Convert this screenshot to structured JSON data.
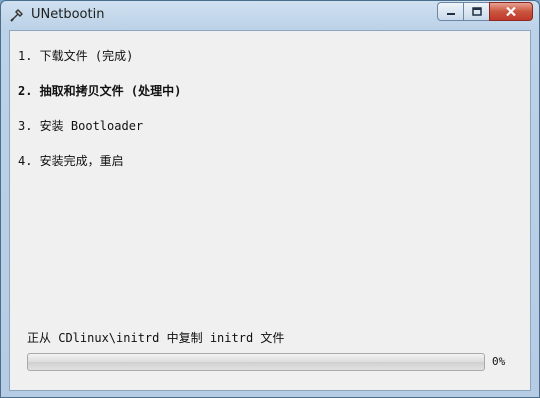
{
  "window": {
    "title": "UNetbootin",
    "icon": "unetbootin-app-icon"
  },
  "steps": [
    {
      "label": "1. 下载文件 (完成)",
      "active": false
    },
    {
      "label": "2. 抽取和拷贝文件 (处理中)",
      "active": true
    },
    {
      "label": "3. 安装 Bootloader",
      "active": false
    },
    {
      "label": "4. 安装完成，重启",
      "active": false
    }
  ],
  "status": {
    "text": "正从 CDlinux\\initrd 中复制 initrd 文件"
  },
  "progress": {
    "value": 0,
    "label": "0%"
  },
  "colors": {
    "title_bar": "#bcd2e8",
    "client_bg": "#f0f0f0",
    "close_button": "#c9553e"
  }
}
